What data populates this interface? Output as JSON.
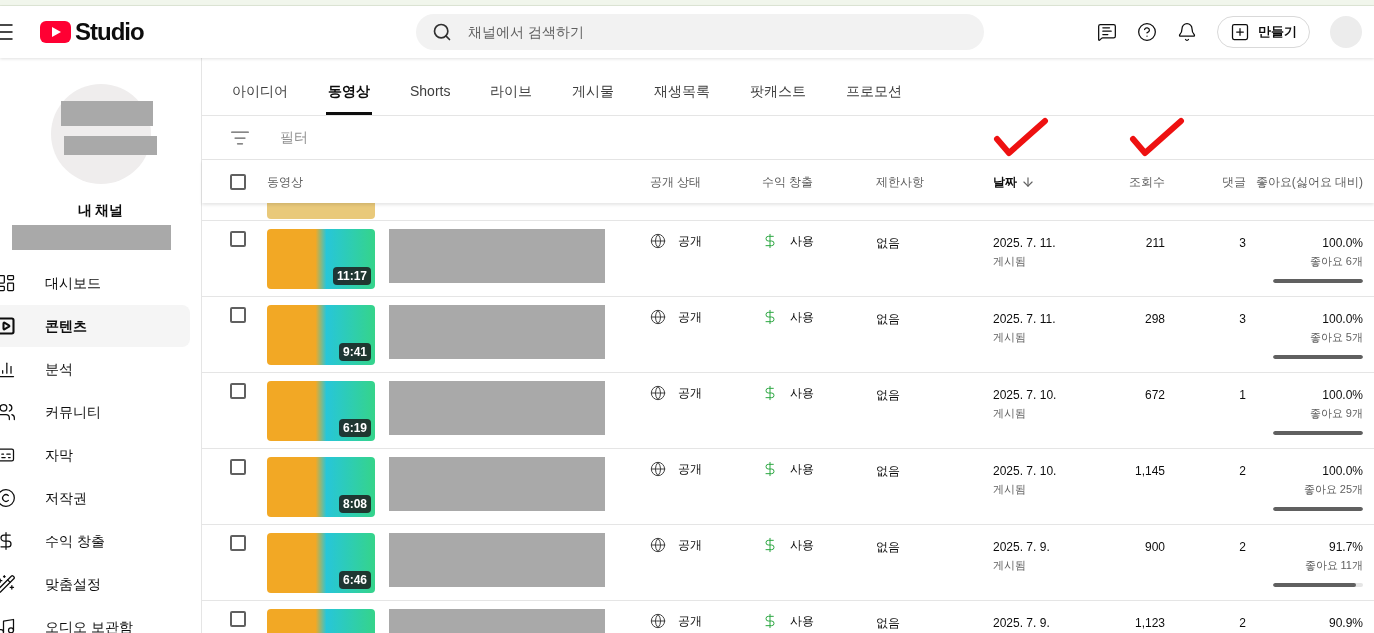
{
  "header": {
    "logo_text": "Studio",
    "search": {
      "placeholder": "채널에서 검색하기"
    },
    "create_button": "만들기"
  },
  "sidebar": {
    "channel_label": "내 채널",
    "items": [
      {
        "label": "대시보드",
        "selected": false
      },
      {
        "label": "콘텐츠",
        "selected": true
      },
      {
        "label": "분석",
        "selected": false
      },
      {
        "label": "커뮤니티",
        "selected": false
      },
      {
        "label": "자막",
        "selected": false
      },
      {
        "label": "저작권",
        "selected": false
      },
      {
        "label": "수익 창출",
        "selected": false
      },
      {
        "label": "맞춤설정",
        "selected": false
      },
      {
        "label": "오디오 보관함",
        "selected": false
      }
    ]
  },
  "tabs": [
    {
      "label": "아이디어",
      "selected": false
    },
    {
      "label": "동영상",
      "selected": true
    },
    {
      "label": "Shorts",
      "selected": false
    },
    {
      "label": "라이브",
      "selected": false
    },
    {
      "label": "게시물",
      "selected": false
    },
    {
      "label": "재생목록",
      "selected": false
    },
    {
      "label": "팟캐스트",
      "selected": false
    },
    {
      "label": "프로모션",
      "selected": false
    }
  ],
  "filter": {
    "placeholder": "필터"
  },
  "table": {
    "all_checked": false,
    "columns": [
      {
        "label": "동영상",
        "sorted": false,
        "marked": false
      },
      {
        "label": "공개 상태",
        "sorted": false,
        "marked": false
      },
      {
        "label": "수익 창출",
        "sorted": false,
        "marked": false
      },
      {
        "label": "제한사항",
        "sorted": false,
        "marked": false
      },
      {
        "label": "날짜",
        "sorted": true,
        "marked": true
      },
      {
        "label": "조회수",
        "sorted": false,
        "marked": true
      },
      {
        "label": "댓글",
        "sorted": false,
        "marked": false
      },
      {
        "label": "좋아요(싫어요 대비)",
        "sorted": false,
        "marked": false
      }
    ],
    "rows": [
      {
        "checked": false,
        "duration": "11:17",
        "visibility": "공개",
        "monetization": "사용",
        "restrictions": "없음",
        "date": "2025. 7. 11.",
        "status": "게시됨",
        "views": "211",
        "comments": "3",
        "like_ratio": "100.0%",
        "likes": "좋아요 6개",
        "level": 1
      },
      {
        "checked": false,
        "duration": "9:41",
        "visibility": "공개",
        "monetization": "사용",
        "restrictions": "없음",
        "date": "2025. 7. 11.",
        "status": "게시됨",
        "views": "298",
        "comments": "3",
        "like_ratio": "100.0%",
        "likes": "좋아요 5개",
        "level": 1
      },
      {
        "checked": false,
        "duration": "6:19",
        "visibility": "공개",
        "monetization": "사용",
        "restrictions": "없음",
        "date": "2025. 7. 10.",
        "status": "게시됨",
        "views": "672",
        "comments": "1",
        "like_ratio": "100.0%",
        "likes": "좋아요 9개",
        "level": 1
      },
      {
        "checked": false,
        "duration": "8:08",
        "visibility": "공개",
        "monetization": "사용",
        "restrictions": "없음",
        "date": "2025. 7. 10.",
        "status": "게시됨",
        "views": "1,145",
        "comments": "2",
        "like_ratio": "100.0%",
        "likes": "좋아요 25개",
        "level": 1
      },
      {
        "checked": false,
        "duration": "6:46",
        "visibility": "공개",
        "monetization": "사용",
        "restrictions": "없음",
        "date": "2025. 7. 9.",
        "status": "게시됨",
        "views": "900",
        "comments": "2",
        "like_ratio": "91.7%",
        "likes": "좋아요 11개",
        "level": 0.917
      },
      {
        "checked": false,
        "visibility": "공개",
        "monetization": "사용",
        "restrictions": "없음",
        "date": "2025. 7. 9.",
        "views": "1,123",
        "comments": "2",
        "like_ratio": "90.9%"
      }
    ]
  }
}
